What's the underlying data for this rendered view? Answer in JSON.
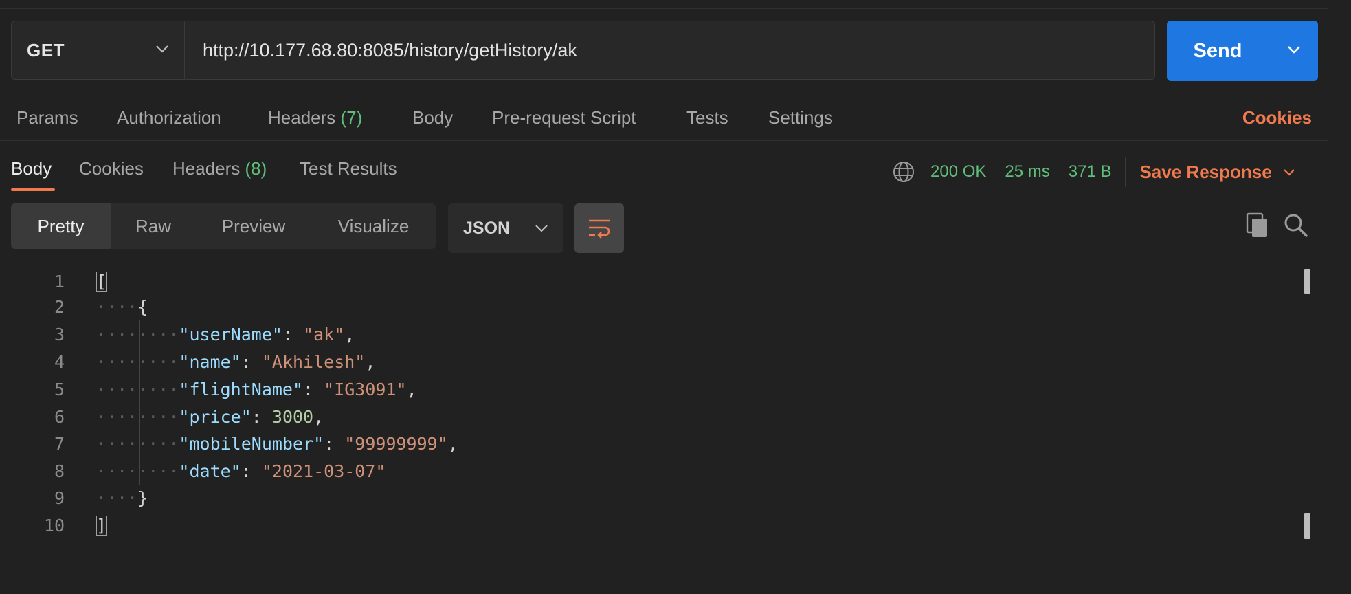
{
  "request": {
    "method": "GET",
    "url": "http://10.177.68.80:8085/history/getHistory/ak",
    "send_label": "Send"
  },
  "request_tabs": {
    "params": "Params",
    "authorization": "Authorization",
    "headers": "Headers",
    "headers_count": "(7)",
    "body": "Body",
    "pre_request": "Pre-request Script",
    "tests": "Tests",
    "settings": "Settings",
    "cookies": "Cookies"
  },
  "response_tabs": {
    "body": "Body",
    "cookies": "Cookies",
    "headers": "Headers",
    "headers_count": "(8)",
    "test_results": "Test Results"
  },
  "response_status": {
    "status": "200 OK",
    "time": "25 ms",
    "size": "371 B",
    "save_label": "Save Response"
  },
  "format": {
    "modes": [
      "Pretty",
      "Raw",
      "Preview",
      "Visualize"
    ],
    "active_mode": "Pretty",
    "language": "JSON"
  },
  "code_lines": [
    {
      "n": "1",
      "text": "["
    },
    {
      "n": "2",
      "text": "{"
    },
    {
      "n": "3",
      "key": "\"userName\"",
      "sep": ": ",
      "value": "\"ak\"",
      "type": "str",
      "trail": ","
    },
    {
      "n": "4",
      "key": "\"name\"",
      "sep": ": ",
      "value": "\"Akhilesh\"",
      "type": "str",
      "trail": ","
    },
    {
      "n": "5",
      "key": "\"flightName\"",
      "sep": ": ",
      "value": "\"IG3091\"",
      "type": "str",
      "trail": ","
    },
    {
      "n": "6",
      "key": "\"price\"",
      "sep": ": ",
      "value": "3000",
      "type": "num",
      "trail": ","
    },
    {
      "n": "7",
      "key": "\"mobileNumber\"",
      "sep": ": ",
      "value": "\"99999999\"",
      "type": "str",
      "trail": ","
    },
    {
      "n": "8",
      "key": "\"date\"",
      "sep": ": ",
      "value": "\"2021-03-07\"",
      "type": "str",
      "trail": ""
    },
    {
      "n": "9",
      "text": "}"
    },
    {
      "n": "10",
      "text": "]"
    }
  ],
  "icons": {
    "method_caret": "chevron-down-icon",
    "send_caret": "chevron-down-icon",
    "globe": "globe-icon",
    "save_caret": "chevron-down-icon",
    "json_caret": "chevron-down-icon",
    "wrap": "wrap-lines-icon",
    "copy": "copy-icon",
    "search": "search-icon"
  },
  "colors": {
    "accent": "#f07a4e",
    "send": "#1f78e1",
    "status_green": "#5fbf7a"
  }
}
